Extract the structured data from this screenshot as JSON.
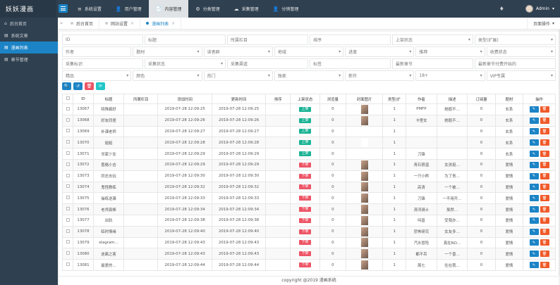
{
  "app": {
    "logo": "妖妖漫画"
  },
  "topnav": [
    {
      "icon": "≡",
      "label": "系统设置",
      "active": false
    },
    {
      "icon": "👤",
      "label": "用户管理",
      "active": false
    },
    {
      "icon": "📄",
      "label": "内容管理",
      "active": true
    },
    {
      "icon": "⚙",
      "label": "分类管理",
      "active": false
    },
    {
      "icon": "☁",
      "label": "采集管理",
      "active": false
    },
    {
      "icon": "👤",
      "label": "分销管理",
      "active": false
    }
  ],
  "user": {
    "name": "Admin",
    "caret": "▾"
  },
  "sidebar": [
    {
      "icon": "⌂",
      "label": "后台首页",
      "active": false
    },
    {
      "icon": "▤",
      "label": "系统文章",
      "active": false
    },
    {
      "icon": "▤",
      "label": "漫画列表",
      "active": true
    },
    {
      "icon": "▤",
      "label": "章节管理",
      "active": false
    }
  ],
  "tabs": [
    {
      "label": "后台首页",
      "closable": false,
      "active": false
    },
    {
      "label": "网站设置",
      "closable": true,
      "active": false
    },
    {
      "label": "漫画列表",
      "closable": true,
      "active": true
    }
  ],
  "tab_right": {
    "label": "页面操作",
    "caret": "▾"
  },
  "filters": [
    [
      {
        "label": "ID",
        "sel": false
      },
      {
        "label": "标题",
        "sel": false
      },
      {
        "label": "所属栏目",
        "sel": false
      },
      {
        "label": "排序",
        "sel": false
      },
      {
        "label": "上架状态",
        "sel": true
      },
      {
        "label": "类型(扩展)",
        "sel": true
      }
    ],
    [
      {
        "label": "作者",
        "sel": false
      },
      {
        "label": "题材",
        "sel": true
      },
      {
        "label": "读者群",
        "sel": true
      },
      {
        "label": "地域",
        "sel": true
      },
      {
        "label": "进度",
        "sel": true
      },
      {
        "label": "推荐",
        "sel": true
      },
      {
        "label": "收费状态",
        "sel": true
      }
    ],
    [
      {
        "label": "采集标识",
        "sel": false
      },
      {
        "label": "采集状态",
        "sel": true
      },
      {
        "label": "采集渠道",
        "sel": false
      },
      {
        "label": "标签",
        "sel": false
      },
      {
        "label": "最新章节",
        "sel": false
      },
      {
        "label": "最新章节付费开始的",
        "sel": false
      }
    ],
    [
      {
        "label": "精品",
        "sel": true
      },
      {
        "label": "颜色",
        "sel": true
      },
      {
        "label": "热门",
        "sel": true
      },
      {
        "label": "独家",
        "sel": true
      },
      {
        "label": "新作",
        "sel": true
      },
      {
        "label": "18+",
        "sel": true
      },
      {
        "label": "VIP专属",
        "sel": true
      }
    ]
  ],
  "action_buttons": [
    {
      "name": "search-button",
      "icon": "🔍",
      "color": "blue"
    },
    {
      "name": "reset-button",
      "icon": "↺",
      "color": "blue"
    },
    {
      "name": "delete-button",
      "icon": "🗑",
      "color": "red"
    },
    {
      "name": "refresh-button",
      "icon": "⟳",
      "color": "cyan"
    }
  ],
  "table": {
    "columns": [
      "",
      "ID",
      "标题",
      "所属栏目",
      "添加时间",
      "更新时间",
      "排序",
      "上架状态",
      "浏览量",
      "封面图片",
      "类型(扩",
      "作者",
      "描述",
      "订阅量",
      "题材",
      "操作"
    ],
    "rows": [
      [
        "13067",
        "特殊癖好",
        "",
        "2019-07-28 12:09:25",
        "2019-07-28 12:09:25",
        "",
        "上架",
        "0",
        "",
        "1",
        "PMFP",
        "她般不…",
        "0",
        "玄系"
      ],
      [
        "13068",
        "好友同居",
        "",
        "2019-07-28 12:09:26",
        "2019-07-28 12:09:26",
        "",
        "上架",
        "0",
        "",
        "1",
        "卡里女",
        "她般不…",
        "0",
        "玄系"
      ],
      [
        "13069",
        "补课老师",
        "",
        "2019-07-28 12:09:27",
        "2019-07-28 12:09:27",
        "",
        "上架",
        "0",
        "",
        "1",
        "",
        "",
        "0",
        "玄系"
      ],
      [
        "13070",
        "姐姐",
        "",
        "2019-07-28 12:09:28",
        "2019-07-28 12:09:28",
        "",
        "上架",
        "0",
        "",
        "1",
        "",
        "",
        "0",
        "玄系"
      ],
      [
        "13071",
        "邻家少女",
        "",
        "2019-07-28 12:09:29",
        "2019-07-28 12:09:29",
        "",
        "上架",
        "0",
        "",
        "1",
        "刀锋",
        "",
        "0",
        "玄系"
      ],
      [
        "13072",
        "香格小吉",
        "",
        "2019-07-28 12:09:29",
        "2019-07-28 12:09:29",
        "",
        "下架",
        "0",
        "",
        "1",
        "青石很温",
        "女孩挺…",
        "0",
        "爱情"
      ],
      [
        "13073",
        "同志去玩",
        "",
        "2019-07-28 12:09:30",
        "2019-07-28 12:09:30",
        "",
        "下架",
        "0",
        "",
        "1",
        "一只小熊",
        "为了青…",
        "0",
        "爱情"
      ],
      [
        "13074",
        "鬼怪教练",
        "",
        "2019-07-28 12:09:32",
        "2019-07-28 12:09:32",
        "",
        "下架",
        "0",
        "",
        "1",
        "高清",
        "一个被…",
        "0",
        "爱情"
      ],
      [
        "13075",
        "操练逆袭",
        "",
        "2019-07-28 12:09:33",
        "2019-07-28 12:09:33",
        "",
        "下架",
        "0",
        "",
        "1",
        "刀锋",
        "一不用开…",
        "0",
        "爱情"
      ],
      [
        "13076",
        "老师真棒",
        "",
        "2019-07-28 12:09:34",
        "2019-07-28 12:09:34",
        "",
        "下架",
        "0",
        "",
        "1",
        "清河骑士",
        "虽然…",
        "0",
        "爱情"
      ],
      [
        "13077",
        "出轨",
        "",
        "2019-07-28 12:09:38",
        "2019-07-28 12:09:38",
        "",
        "下架",
        "0",
        "",
        "1",
        "叫兽",
        "受我办…",
        "0",
        "爱情"
      ],
      [
        "13078",
        "临时情缘",
        "",
        "2019-07-28 12:09:40",
        "2019-07-28 12:09:40",
        "",
        "下架",
        "0",
        "",
        "1",
        "恐怖研究",
        "女友多…",
        "0",
        "爱情"
      ],
      [
        "13079",
        "stagram…",
        "",
        "2019-07-28 12:09:43",
        "2019-07-28 12:09:43",
        "",
        "下架",
        "0",
        "",
        "1",
        "汽水冒险",
        "真在NO…",
        "0",
        "爱情"
      ],
      [
        "13080",
        "迷离之客",
        "",
        "2019-07-28 12:09:43",
        "2019-07-28 12:09:43",
        "",
        "下架",
        "0",
        "",
        "1",
        "都不吊",
        "一个普…",
        "0",
        "爱情"
      ],
      [
        "13081",
        "最爱的…",
        "",
        "2019-07-28 12:09:44",
        "2019-07-28 12:09:44",
        "",
        "下架",
        "0",
        "",
        "1",
        "周七",
        "住在我…",
        "0",
        "爱情"
      ]
    ],
    "edit_icon": "✎",
    "delete_icon": "🗑"
  },
  "footer": {
    "text": "copyright @2019 漫画系统"
  },
  "colors": {
    "primary": "#1c84c6",
    "sidebar": "#2f4050",
    "success": "#1ab394",
    "danger": "#ed5565"
  }
}
